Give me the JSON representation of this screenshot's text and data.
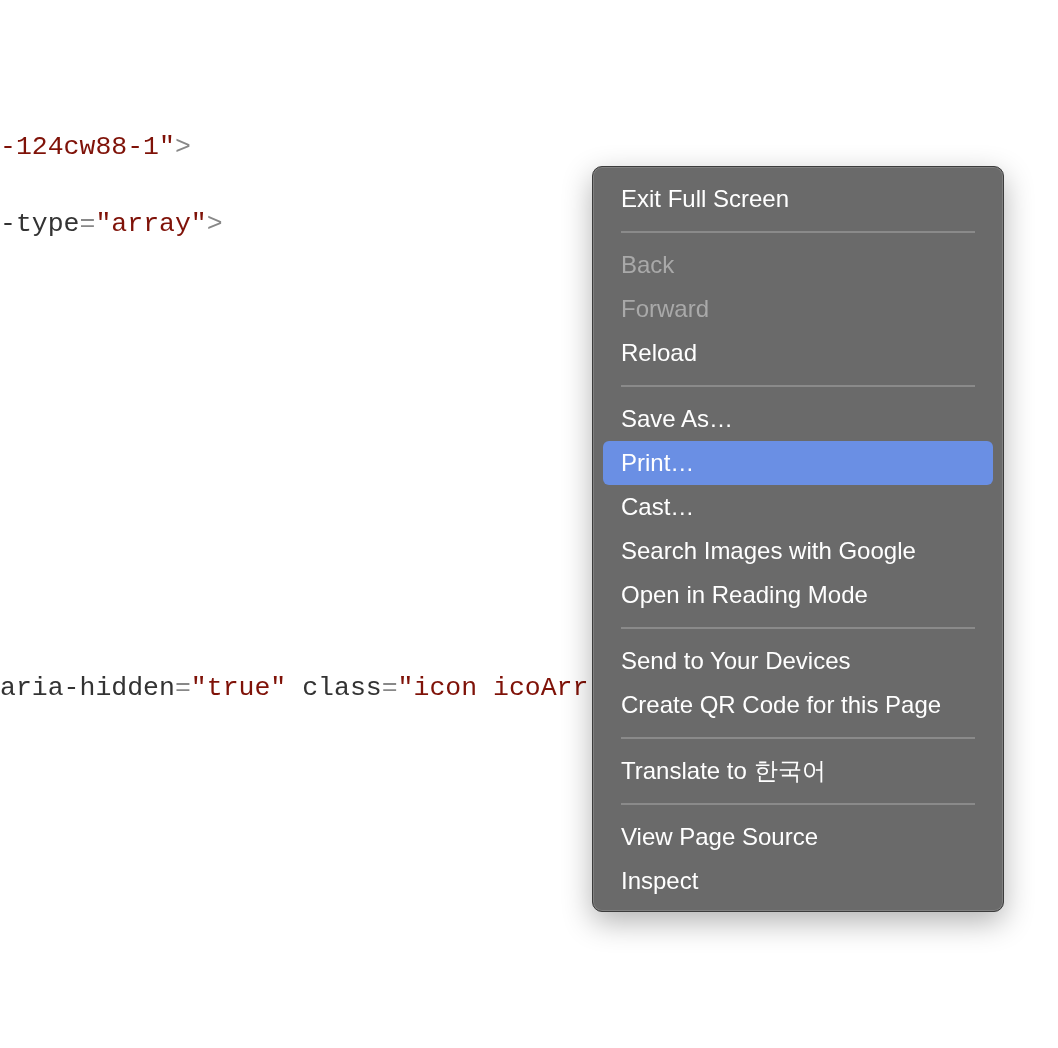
{
  "code_lines": [
    {
      "tokens": [
        {
          "kind": "value",
          "text": "-124cw88-1\""
        },
        {
          "kind": "punct",
          "text": ">"
        }
      ]
    },
    {
      "tokens": [
        {
          "kind": "attr",
          "text": "-type"
        },
        {
          "kind": "punct",
          "text": "="
        },
        {
          "kind": "value",
          "text": "\"array\""
        },
        {
          "kind": "punct",
          "text": ">"
        }
      ]
    },
    {
      "tokens": [
        {
          "kind": "attr",
          "text": "aria-hidden"
        },
        {
          "kind": "punct",
          "text": "="
        },
        {
          "kind": "value",
          "text": "\"true\""
        },
        {
          "kind": "attr",
          "text": " class"
        },
        {
          "kind": "punct",
          "text": "="
        },
        {
          "kind": "value",
          "text": "\"icon icoArr"
        }
      ]
    }
  ],
  "context_menu": {
    "items": [
      {
        "kind": "item",
        "label": "Exit Full Screen",
        "disabled": false,
        "selected": false
      },
      {
        "kind": "separator"
      },
      {
        "kind": "item",
        "label": "Back",
        "disabled": true,
        "selected": false
      },
      {
        "kind": "item",
        "label": "Forward",
        "disabled": true,
        "selected": false
      },
      {
        "kind": "item",
        "label": "Reload",
        "disabled": false,
        "selected": false
      },
      {
        "kind": "separator"
      },
      {
        "kind": "item",
        "label": "Save As…",
        "disabled": false,
        "selected": false
      },
      {
        "kind": "item",
        "label": "Print…",
        "disabled": false,
        "selected": true
      },
      {
        "kind": "item",
        "label": "Cast…",
        "disabled": false,
        "selected": false
      },
      {
        "kind": "item",
        "label": "Search Images with Google",
        "disabled": false,
        "selected": false
      },
      {
        "kind": "item",
        "label": "Open in Reading Mode",
        "disabled": false,
        "selected": false
      },
      {
        "kind": "separator"
      },
      {
        "kind": "item",
        "label": "Send to Your Devices",
        "disabled": false,
        "selected": false
      },
      {
        "kind": "item",
        "label": "Create QR Code for this Page",
        "disabled": false,
        "selected": false
      },
      {
        "kind": "separator"
      },
      {
        "kind": "item",
        "label": "Translate to 한국어",
        "disabled": false,
        "selected": false
      },
      {
        "kind": "separator"
      },
      {
        "kind": "item",
        "label": "View Page Source",
        "disabled": false,
        "selected": false
      },
      {
        "kind": "item",
        "label": "Inspect",
        "disabled": false,
        "selected": false
      }
    ]
  }
}
